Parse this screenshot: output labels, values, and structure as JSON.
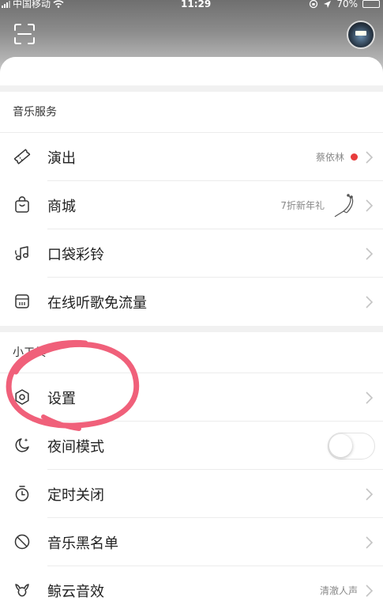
{
  "status_bar": {
    "carrier": "中国移动",
    "time": "11:29",
    "battery_percent": "70%",
    "battery_level": 0.7
  },
  "header": {
    "scan_icon": "scan-icon",
    "avatar": "user-avatar"
  },
  "sections": [
    {
      "title": "音乐服务",
      "items": [
        {
          "label": "演出",
          "icon": "ticket-icon",
          "extra": "蔡依林",
          "has_red_dot": true
        },
        {
          "label": "商城",
          "icon": "shopping-bag-icon",
          "extra": "7折新年礼",
          "has_product_image": true
        },
        {
          "label": "口袋彩铃",
          "icon": "music-note-icon"
        },
        {
          "label": "在线听歌免流量",
          "icon": "sim-card-icon"
        }
      ]
    },
    {
      "title": "小工具",
      "items": [
        {
          "label": "设置",
          "icon": "settings-icon"
        },
        {
          "label": "夜间模式",
          "icon": "moon-icon",
          "toggle_on": false
        },
        {
          "label": "定时关闭",
          "icon": "timer-icon"
        },
        {
          "label": "音乐黑名单",
          "icon": "block-icon"
        },
        {
          "label": "鲸云音效",
          "icon": "whale-icon",
          "extra": "清澈人声"
        }
      ]
    }
  ],
  "colors": {
    "red_dot": "#e83c3c",
    "annotation_stroke": "#f0607a",
    "icon_stroke": "#333333",
    "chevron": "#c4c4c4"
  }
}
